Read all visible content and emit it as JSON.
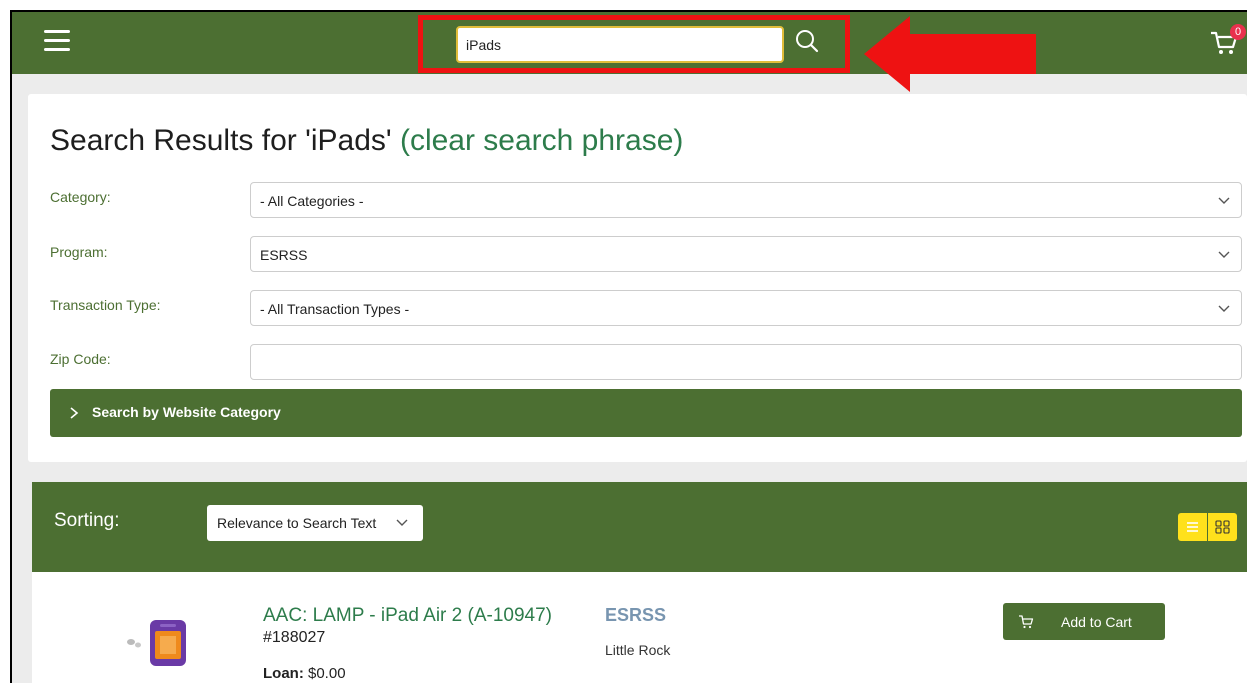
{
  "header": {
    "search_value": "iPads",
    "cart_count": "0"
  },
  "results": {
    "title_prefix": "Search Results for 'iPads'",
    "clear_link": "(clear search phrase)"
  },
  "filters": {
    "category_label": "Category:",
    "category_value": "- All Categories -",
    "program_label": "Program:",
    "program_value": "ESRSS",
    "transaction_label": "Transaction Type:",
    "transaction_value": "- All Transaction Types -",
    "zip_label": "Zip Code:",
    "zip_value": "",
    "website_category": "Search by Website Category"
  },
  "sorting": {
    "label": "Sorting:",
    "value": "Relevance to Search Text"
  },
  "products": [
    {
      "title": "AAC: LAMP - iPad Air 2 (A-10947)",
      "id": "#188027",
      "loan_label": "Loan:",
      "loan_value": "$0.00",
      "program": "ESRSS",
      "location": "Little Rock",
      "add_label": "Add to Cart"
    }
  ],
  "colors": {
    "brand_green": "#4c6f32",
    "link_green": "#2d7c4b",
    "highlight_red": "#ee1212",
    "accent_yellow": "#ffe11c"
  }
}
